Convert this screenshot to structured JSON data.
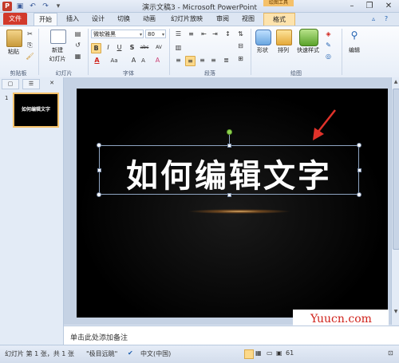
{
  "window": {
    "title": "演示文稿3 - Microsoft PowerPoint",
    "picture_tools_label": "绘图工具"
  },
  "tabs": [
    "文件",
    "开始",
    "插入",
    "设计",
    "切换",
    "动画",
    "幻灯片放映",
    "审阅",
    "视图",
    "格式"
  ],
  "ribbon": {
    "clipboard": {
      "paste_label": "粘贴",
      "group_label": "剪贴板"
    },
    "slides": {
      "new_slide_label": "新建\n幻灯片",
      "new_label": "新建",
      "slide_label": "幻灯片",
      "group_label": "幻灯片"
    },
    "font": {
      "font_name": "微软雅黑",
      "font_size": "80",
      "group_label": "字体",
      "bold": "B",
      "italic": "I",
      "underline": "U",
      "strike": "S",
      "shadow": "abc",
      "char_space": "AV",
      "case": "Aa",
      "font_color": "A",
      "grow": "A",
      "shrink": "A",
      "clear": "A"
    },
    "paragraph": {
      "group_label": "段落"
    },
    "drawing": {
      "shape_label": "形状",
      "arrange_label": "排列",
      "quick_styles_label": "快速样式",
      "group_label": "绘图"
    },
    "editing": {
      "label": "编辑"
    }
  },
  "pane": {
    "slide_number": "1",
    "thumb_text": "如何编辑文字"
  },
  "slide": {
    "title": "如何编辑文字"
  },
  "notes": {
    "placeholder": "单击此处添加备注"
  },
  "watermark": {
    "text": "Yuucn.com"
  },
  "status": {
    "slide_info": "幻灯片 第 1 张，共 1 张",
    "theme": "\"极目远眺\"",
    "language": "中文(中国)",
    "zoom": "61"
  },
  "colors": {
    "file_tab": "#d2392b",
    "accent_arrow": "#e0322a",
    "selection_border": "#8fa5c2"
  }
}
